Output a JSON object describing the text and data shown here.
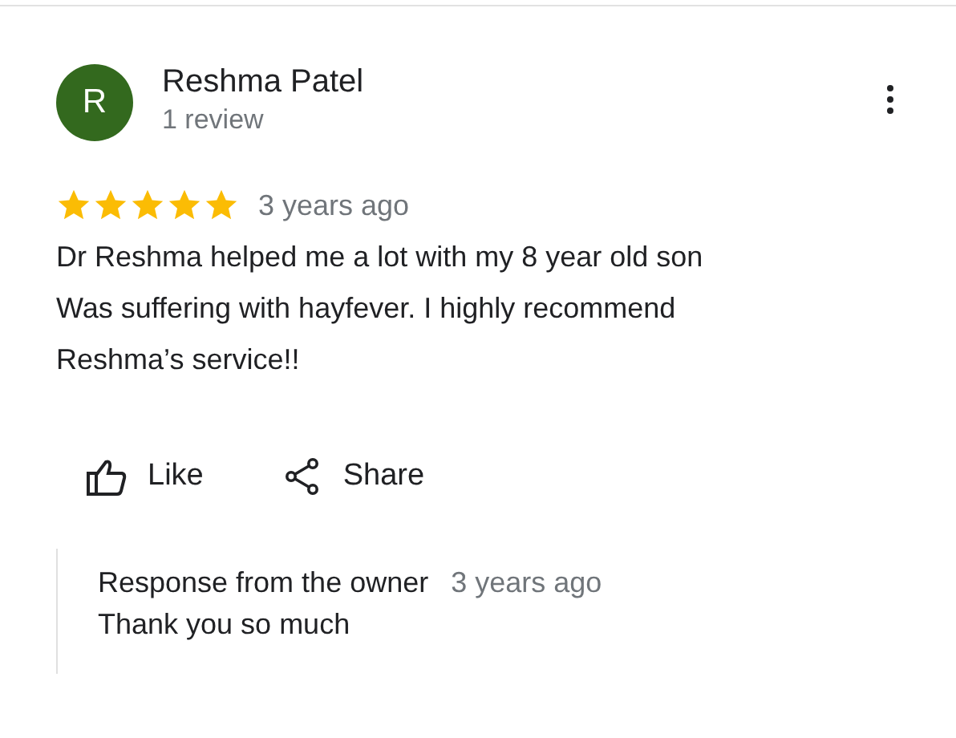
{
  "reviewer": {
    "initial": "R",
    "name": "Reshma Patel",
    "review_count": "1 review"
  },
  "review": {
    "stars": 5,
    "time": "3 years ago",
    "text": "Dr Reshma helped me a lot with my 8 year old son\nWas suffering with hayfever. I highly recommend Reshma’s service!!"
  },
  "actions": [
    {
      "kind": "like",
      "label": "Like"
    },
    {
      "kind": "share",
      "label": "Share"
    }
  ],
  "owner_response": {
    "title": "Response from the owner",
    "time": "3 years ago",
    "text": "Thank you so much"
  }
}
